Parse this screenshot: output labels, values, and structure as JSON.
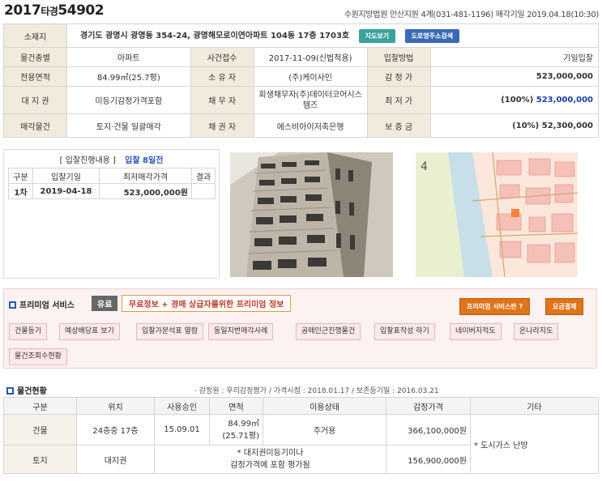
{
  "case": {
    "year": "2017",
    "type": "타경",
    "number": "54902"
  },
  "court_info": "수원지방법원 안산지원 4계(031-481-1196) 매각기일 2019.04.18(10:30)",
  "info": {
    "address_label": "소재지",
    "address": "경기도 광명시 광명동 354-24, 광명해모로이연아파트 104동 17층 1703호",
    "map_btn": "지도보기",
    "road_btn": "도로명주소검색",
    "rows": [
      {
        "l1": "물건종별",
        "v1": "아파트",
        "l2": "사건접수",
        "v2": "2017-11-09(신법적용)",
        "l3": "입찰방법",
        "v3": "기일입찰"
      },
      {
        "l1": "전용면적",
        "v1": "84.99㎡(25.7평)",
        "l2": "소 유 자",
        "v2": "(주)케이사인",
        "l3": "감 정 가",
        "v3": "523,000,000"
      },
      {
        "l1": "대 지 권",
        "v1": "미등기감정가격포함",
        "l2": "채 무 자",
        "v2": "회생채무자(주)데이터코어시스템즈",
        "l3": "최 저 가",
        "v3_pct": "(100%)",
        "v3": "523,000,000"
      },
      {
        "l1": "매각물건",
        "v1": "토지·건물 일괄매각",
        "l2": "채 권 자",
        "v2": "에스비아이저축은행",
        "l3": "보 증 금",
        "v3_pct": "(10%)",
        "v3": "52,300,000"
      }
    ]
  },
  "bid": {
    "title": "[ 입찰진행내용 ]",
    "dday": "입찰 8일전",
    "headers": [
      "구분",
      "입찰기일",
      "최저매각가격",
      "결과"
    ],
    "rows": [
      {
        "round": "1차",
        "date": "2019-04-18",
        "price": "523,000,000원",
        "result": ""
      }
    ]
  },
  "premium": {
    "title": "프리미엄 서비스",
    "badge": "유료",
    "desc": "무료정보 + 경매 상급자를위한 프리미엄 정보",
    "what_btn": "프리미엄 서비스란 ?",
    "pay_btn": "요금결제",
    "tags": [
      "건물등기",
      "예상배당표 보기",
      "입찰가분석표 열람",
      "동일지번매각사례",
      "공매인근진행물건",
      "입찰표작성 하기",
      "네이버지적도",
      "온나라지도",
      "물건조회수현황"
    ]
  },
  "status": {
    "title": "물건현황",
    "sub": "· 감정원 : 우리감정평가 / 가격시점 : 2018.01.17 / 보존등기일 : 2016.03.21",
    "headers": [
      "구분",
      "위치",
      "사용승인",
      "면적",
      "이용상태",
      "감정가격",
      "기타"
    ],
    "building": {
      "label": "건물",
      "loc": "24층중 17층",
      "approval": "15.09.01",
      "area1": "84.99㎡",
      "area2": "(25.71평)",
      "use": "주거용",
      "price": "366,100,000원"
    },
    "land": {
      "label": "토지",
      "loc": "대지권",
      "note1": "* 대지권미등기이나",
      "note2": "감정가격에 포함 평가됨",
      "price": "156,900,000원"
    },
    "etc": "* 도시가스 난방"
  },
  "colors": {
    "label_bg": "#f1ebdd",
    "accent_blue": "#1a3fa8",
    "premium_bg": "#fcf2f2",
    "orange": "#e0741a"
  }
}
